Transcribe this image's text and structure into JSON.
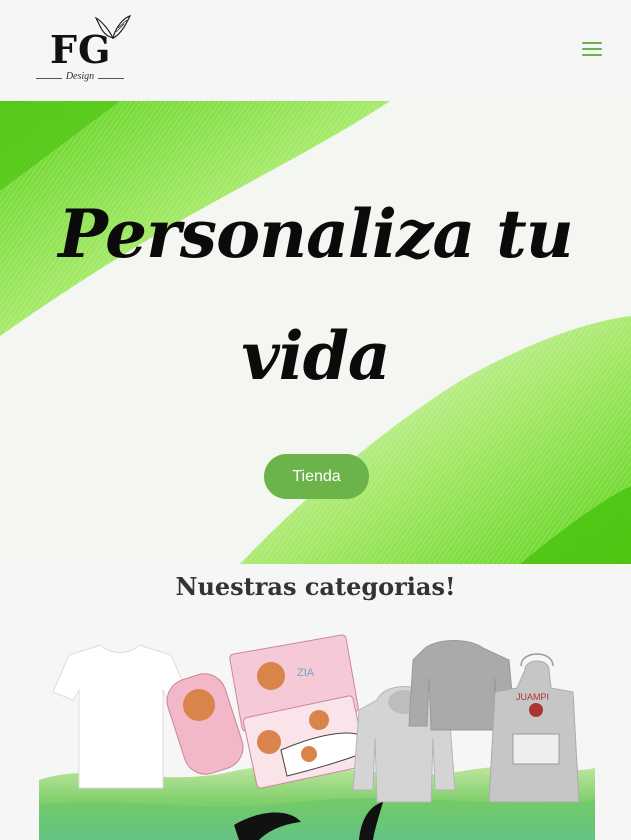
{
  "header": {
    "logo_text": "FG",
    "logo_subtext": "Design"
  },
  "hero": {
    "title": "Personaliza tu vida",
    "button_label": "Tienda"
  },
  "categories": {
    "title": "Nuestras categorias!",
    "shirt_print": "ZIA",
    "apron_print": "JUAMPI"
  },
  "colors": {
    "accent": "#6cb34a",
    "hero_green": "#8fde3c",
    "background": "#f6f6f6"
  },
  "icons": [
    "butterfly-icon",
    "hamburger-menu-icon"
  ]
}
